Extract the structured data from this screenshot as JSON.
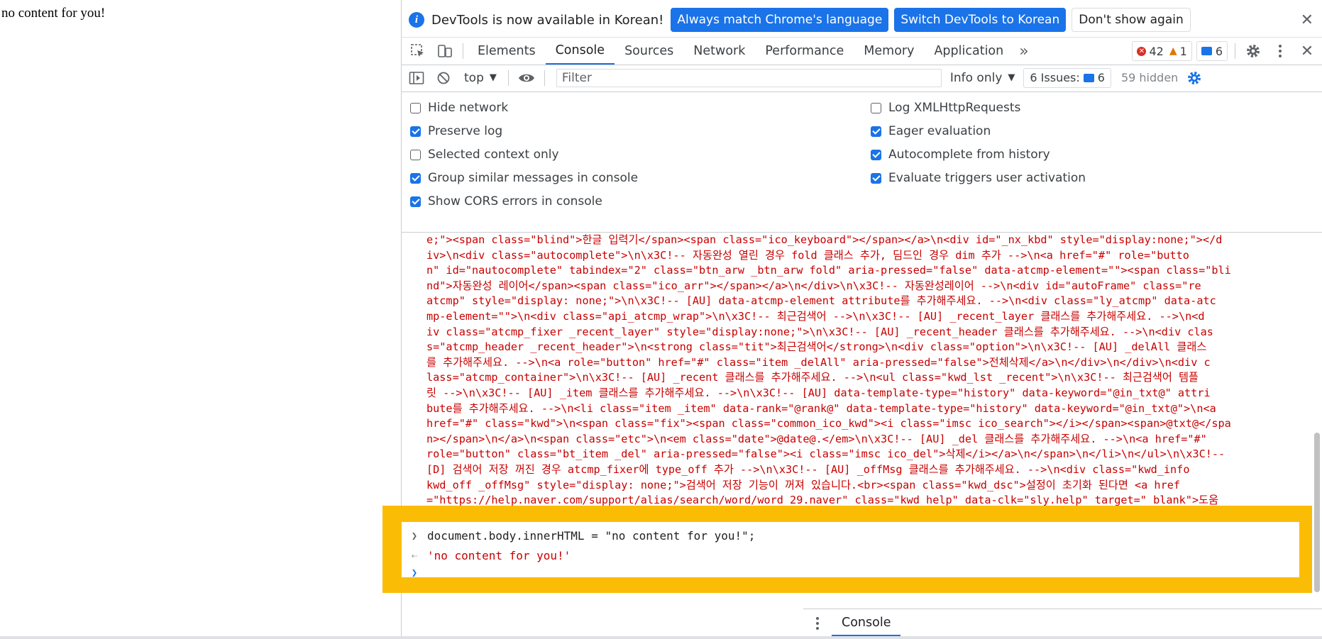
{
  "page": {
    "body_text": "no content for you!"
  },
  "infobar": {
    "message": "DevTools is now available in Korean!",
    "match_language_label": "Always match Chrome's language",
    "switch_label": "Switch DevTools to Korean",
    "dont_show_label": "Don't show again",
    "close_glyph": "✕"
  },
  "tabs": [
    {
      "label": "Elements"
    },
    {
      "label": "Console"
    },
    {
      "label": "Sources"
    },
    {
      "label": "Network"
    },
    {
      "label": "Performance"
    },
    {
      "label": "Memory"
    },
    {
      "label": "Application"
    }
  ],
  "more_tabs_glyph": "»",
  "counters": {
    "errors": "42",
    "warnings": "1",
    "issues": "6"
  },
  "toolbar": {
    "context": "top",
    "filter_placeholder": "Filter",
    "levels": "Info only",
    "issues_label": "6 Issues:",
    "issues_count": "6",
    "hidden_label": "59 hidden"
  },
  "settings": {
    "left": [
      {
        "label": "Hide network",
        "checked": false
      },
      {
        "label": "Preserve log",
        "checked": true
      },
      {
        "label": "Selected context only",
        "checked": false
      },
      {
        "label": "Group similar messages in console",
        "checked": true
      },
      {
        "label": "Show CORS errors in console",
        "checked": true
      }
    ],
    "right": [
      {
        "label": "Log XMLHttpRequests",
        "checked": false
      },
      {
        "label": "Eager evaluation",
        "checked": true
      },
      {
        "label": "Autocomplete from history",
        "checked": true
      },
      {
        "label": "Evaluate triggers user activation",
        "checked": true
      }
    ]
  },
  "log_lines": [
    "e;\"><span class=\"blind\">한글 입력기</span><span class=\"ico_keyboard\"></span></a>\\n<div id=\"_nx_kbd\" style=\"display:none;\"></d",
    "iv>\\n<div class=\"autocomplete\">\\n\\x3C!-- 자동완성 열린 경우 fold 클래스 추가, 딤드인 경우 dim 추가 -->\\n<a href=\"#\" role=\"butto",
    "n\" id=\"nautocomplete\" tabindex=\"2\" class=\"btn_arw _btn_arw fold\" aria-pressed=\"false\" data-atcmp-element=\"\"><span class=\"bli",
    "nd\">자동완성 레이어</span><span class=\"ico_arr\"></span></a>\\n</div>\\n\\x3C!-- 자동완성레이어 -->\\n<div id=\"autoFrame\" class=\"re",
    "atcmp\" style=\"display: none;\">\\n\\x3C!-- [AU] data-atcmp-element attribute를 추가해주세요. -->\\n<div class=\"ly_atcmp\" data-atc",
    "mp-element=\"\">\\n<div class=\"api_atcmp_wrap\">\\n\\x3C!-- 최근검색어 -->\\n\\x3C!-- [AU] _recent_layer 클래스를 추가해주세요. -->\\n<d",
    "iv class=\"atcmp_fixer _recent_layer\" style=\"display:none;\">\\n\\x3C!-- [AU] _recent_header 클래스를 추가해주세요. -->\\n<div clas",
    "s=\"atcmp_header _recent_header\">\\n<strong class=\"tit\">최근검색어</strong>\\n<div class=\"option\">\\n\\x3C!-- [AU] _delAll 클래스",
    "를 추가해주세요. -->\\n<a role=\"button\" href=\"#\" class=\"item _delAll\" aria-pressed=\"false\">전체삭제</a>\\n</div>\\n</div>\\n<div c",
    "lass=\"atcmp_container\">\\n\\x3C!-- [AU] _recent 클래스를 추가해주세요. -->\\n<ul class=\"kwd_lst _recent\">\\n\\x3C!-- 최근검색어 템플",
    "릿 -->\\n\\x3C!-- [AU] _item 클래스를 추가해주세요. -->\\n\\x3C!-- [AU] data-template-type=\"history\" data-keyword=\"@in_txt@\" attri",
    "bute를 추가해주세요. -->\\n<li class=\"item _item\" data-rank=\"@rank@\" data-template-type=\"history\" data-keyword=\"@in_txt@\">\\n<a",
    "href=\"#\" class=\"kwd\">\\n<span class=\"fix\"><span class=\"common_ico_kwd\"><i class=\"imsc ico_search\"></i></span><span>@txt@</spa",
    "n></span>\\n</a>\\n<span class=\"etc\">\\n<em class=\"date\">@date@.</em>\\n\\x3C!-- [AU] _del 클래스를 추가해주세요. -->\\n<a href=\"#\"",
    "role=\"button\" class=\"bt_item _del\" aria-pressed=\"false\"><i class=\"imsc ico_del\">삭제</i></a>\\n</span>\\n</li>\\n</ul>\\n\\x3C!--",
    "[D] 검색어 저장 꺼진 경우 atcmp_fixer에 type_off 추가 -->\\n\\x3C!-- [AU] _offMsg 클래스를 추가해주세요. -->\\n<div class=\"kwd_info",
    "kwd_off _offMsg\" style=\"display: none;\">검색어 저장 기능이 꺼져 있습니다.<br><span class=\"kwd_dsc\">설정이 초기화 된다면 <a href",
    "=\"https://help.naver.com/support/alias/search/word/word_29.naver\" class=\"kwd_help\" data-clk=\"sly.help\" target=\"_blank\">도움"
  ],
  "console_io": {
    "command": "document.body.innerHTML = \"no content for you!\";",
    "result": "'no content for you!'"
  },
  "drawer": {
    "tab_label": "Console",
    "close_glyph": "✕"
  },
  "colors": {
    "accent": "#1a73e8",
    "highlight": "#fbbc05",
    "string_red": "#c80000"
  }
}
